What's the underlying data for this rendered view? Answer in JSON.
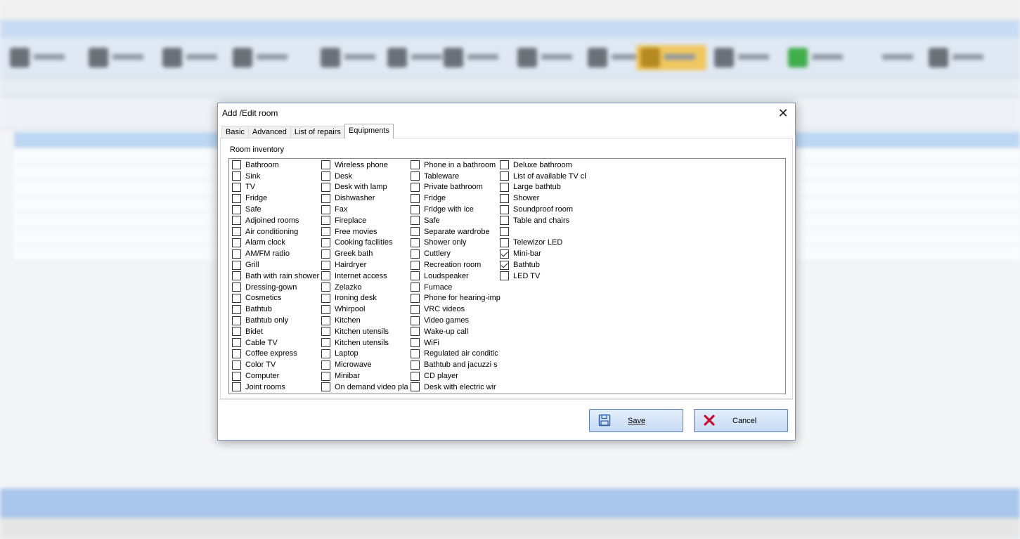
{
  "dialog": {
    "title": "Add /Edit room",
    "tabs": [
      {
        "label": "Basic",
        "active": false
      },
      {
        "label": "Advanced",
        "active": false
      },
      {
        "label": "List of repairs",
        "active": false
      },
      {
        "label": "Equipments",
        "active": true
      }
    ],
    "group_label": "Room inventory",
    "columns": [
      [
        {
          "label": "Bathroom",
          "checked": false
        },
        {
          "label": "Sink",
          "checked": false
        },
        {
          "label": "TV",
          "checked": false
        },
        {
          "label": "Fridge",
          "checked": false
        },
        {
          "label": "Safe",
          "checked": false
        },
        {
          "label": "Adjoined rooms",
          "checked": false
        },
        {
          "label": "Air conditioning",
          "checked": false
        },
        {
          "label": "Alarm clock",
          "checked": false
        },
        {
          "label": "AM/FM radio",
          "checked": false
        },
        {
          "label": "Grill",
          "checked": false
        },
        {
          "label": "Bath with rain shower",
          "checked": false
        },
        {
          "label": "Dressing-gown",
          "checked": false
        },
        {
          "label": "Cosmetics",
          "checked": false
        },
        {
          "label": "Bathtub",
          "checked": false
        },
        {
          "label": "Bathtub only",
          "checked": false
        },
        {
          "label": "Bidet",
          "checked": false
        },
        {
          "label": "Cable TV",
          "checked": false
        },
        {
          "label": "Coffee express",
          "checked": false
        },
        {
          "label": "Color TV",
          "checked": false
        },
        {
          "label": "Computer",
          "checked": false
        },
        {
          "label": "Joint rooms",
          "checked": false
        }
      ],
      [
        {
          "label": "Wireless phone",
          "checked": false
        },
        {
          "label": "Desk",
          "checked": false
        },
        {
          "label": "Desk with lamp",
          "checked": false
        },
        {
          "label": "Dishwasher",
          "checked": false
        },
        {
          "label": "Fax",
          "checked": false
        },
        {
          "label": "Fireplace",
          "checked": false
        },
        {
          "label": "Free movies",
          "checked": false
        },
        {
          "label": "Cooking facilities",
          "checked": false
        },
        {
          "label": "Greek bath",
          "checked": false
        },
        {
          "label": "Hairdryer",
          "checked": false
        },
        {
          "label": "Internet access",
          "checked": false
        },
        {
          "label": "Zelazko",
          "checked": false
        },
        {
          "label": "Ironing desk",
          "checked": false
        },
        {
          "label": "Whirpool",
          "checked": false
        },
        {
          "label": "Kitchen",
          "checked": false
        },
        {
          "label": "Kitchen utensils",
          "checked": false
        },
        {
          "label": "Kitchen utensils",
          "checked": false
        },
        {
          "label": "Laptop",
          "checked": false
        },
        {
          "label": "Microwave",
          "checked": false
        },
        {
          "label": "Minibar",
          "checked": false
        },
        {
          "label": "On demand video pla",
          "checked": false
        }
      ],
      [
        {
          "label": "Phone in a bathroom",
          "checked": false
        },
        {
          "label": "Tableware",
          "checked": false
        },
        {
          "label": "Private bathroom",
          "checked": false
        },
        {
          "label": "Fridge",
          "checked": false
        },
        {
          "label": "Fridge with ice",
          "checked": false
        },
        {
          "label": "Safe",
          "checked": false
        },
        {
          "label": "Separate wardrobe",
          "checked": false
        },
        {
          "label": "Shower only",
          "checked": false
        },
        {
          "label": "Cuttlery",
          "checked": false
        },
        {
          "label": "Recreation room",
          "checked": false
        },
        {
          "label": "Loudspeaker",
          "checked": false
        },
        {
          "label": "Furnace",
          "checked": false
        },
        {
          "label": "Phone for hearing-imp",
          "checked": false
        },
        {
          "label": "VRC videos",
          "checked": false
        },
        {
          "label": "Video games",
          "checked": false
        },
        {
          "label": "Wake-up call",
          "checked": false
        },
        {
          "label": "WiFi",
          "checked": false
        },
        {
          "label": "Regulated air conditic",
          "checked": false
        },
        {
          "label": "Bathtub and jacuzzi s",
          "checked": false
        },
        {
          "label": "CD player",
          "checked": false
        },
        {
          "label": "Desk with electric wir",
          "checked": false
        }
      ],
      [
        {
          "label": "Deluxe bathroom",
          "checked": false
        },
        {
          "label": "List of available TV cl",
          "checked": false
        },
        {
          "label": "Large bathtub",
          "checked": false
        },
        {
          "label": "Shower",
          "checked": false
        },
        {
          "label": "Soundproof room",
          "checked": false
        },
        {
          "label": "Table and chairs",
          "checked": false
        },
        {
          "label": "",
          "checked": false
        },
        {
          "label": "Telewizor LED",
          "checked": false
        },
        {
          "label": "Mini-bar",
          "checked": true
        },
        {
          "label": "Bathtub",
          "checked": true
        },
        {
          "label": "LED TV",
          "checked": false
        }
      ]
    ],
    "save_label": "Save",
    "cancel_label": "Cancel",
    "close_glyph": "✕"
  },
  "colors": {
    "accent_border": "#7a9cc7",
    "button_gradient_top": "#e3eefb",
    "button_gradient_bottom": "#c7dcf5",
    "cancel_x": "#c8102e",
    "save_icon": "#2a5ca8"
  }
}
